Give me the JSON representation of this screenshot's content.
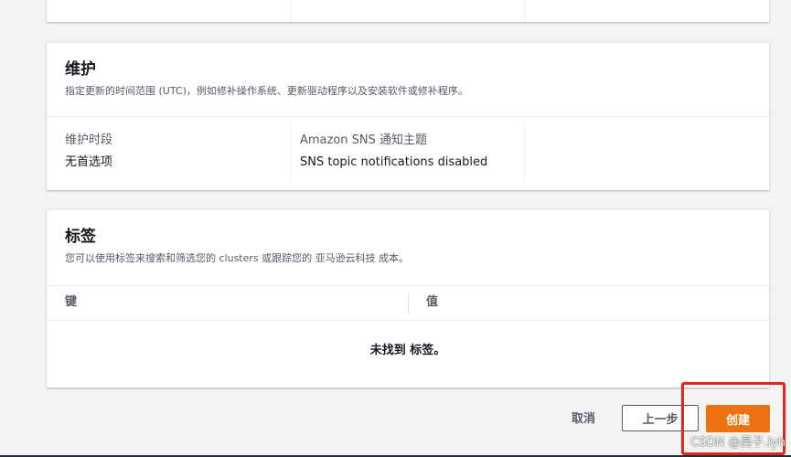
{
  "maintenance": {
    "title": "维护",
    "description": "指定更新的时间范围 (UTC)，例如修补操作系统、更新驱动程序以及安装软件或修补程序。",
    "window_label": "维护时段",
    "window_value": "无首选项",
    "sns_label": "Amazon SNS 通知主题",
    "sns_value": "SNS topic notifications disabled"
  },
  "tags": {
    "title": "标签",
    "description": "您可以使用标签来搜索和筛选您的 clusters 或跟踪您的 亚马逊云科技 成本。",
    "col_key": "键",
    "col_value": "值",
    "empty": "未找到 标签。"
  },
  "actions": {
    "cancel": "取消",
    "previous": "上一步",
    "create": "创建"
  },
  "watermark": "CSDN @昊子.lyh",
  "colors": {
    "primary": "#ec7211",
    "highlight": "#e8231e",
    "page_bg": "#f2f3f3"
  }
}
